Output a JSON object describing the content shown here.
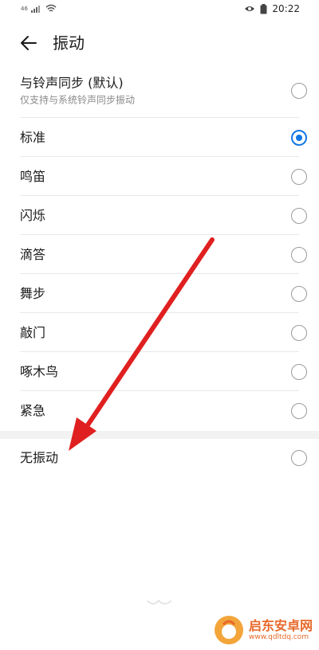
{
  "status_bar": {
    "signal_text": "46",
    "time": "20:22",
    "icons": [
      "signal-icon",
      "wifi-icon",
      "eye-icon",
      "battery-icon"
    ]
  },
  "header": {
    "back_icon": "arrow-left-icon",
    "title": "振动"
  },
  "list": {
    "sync": {
      "title": "与铃声同步 (默认)",
      "subtitle": "仅支持与系统铃声同步振动",
      "checked": false
    },
    "items": [
      {
        "label": "标准",
        "checked": true
      },
      {
        "label": "鸣笛",
        "checked": false
      },
      {
        "label": "闪烁",
        "checked": false
      },
      {
        "label": "滴答",
        "checked": false
      },
      {
        "label": "舞步",
        "checked": false
      },
      {
        "label": "敲门",
        "checked": false
      },
      {
        "label": "啄木鸟",
        "checked": false
      },
      {
        "label": "紧急",
        "checked": false
      }
    ],
    "none": {
      "label": "无振动",
      "checked": false
    }
  },
  "colors": {
    "accent": "#1177e6",
    "annotation_arrow": "#e02020",
    "watermark": "#e8692a"
  },
  "watermark": {
    "title": "启东安卓网",
    "url": "www.qdltdq.com"
  }
}
